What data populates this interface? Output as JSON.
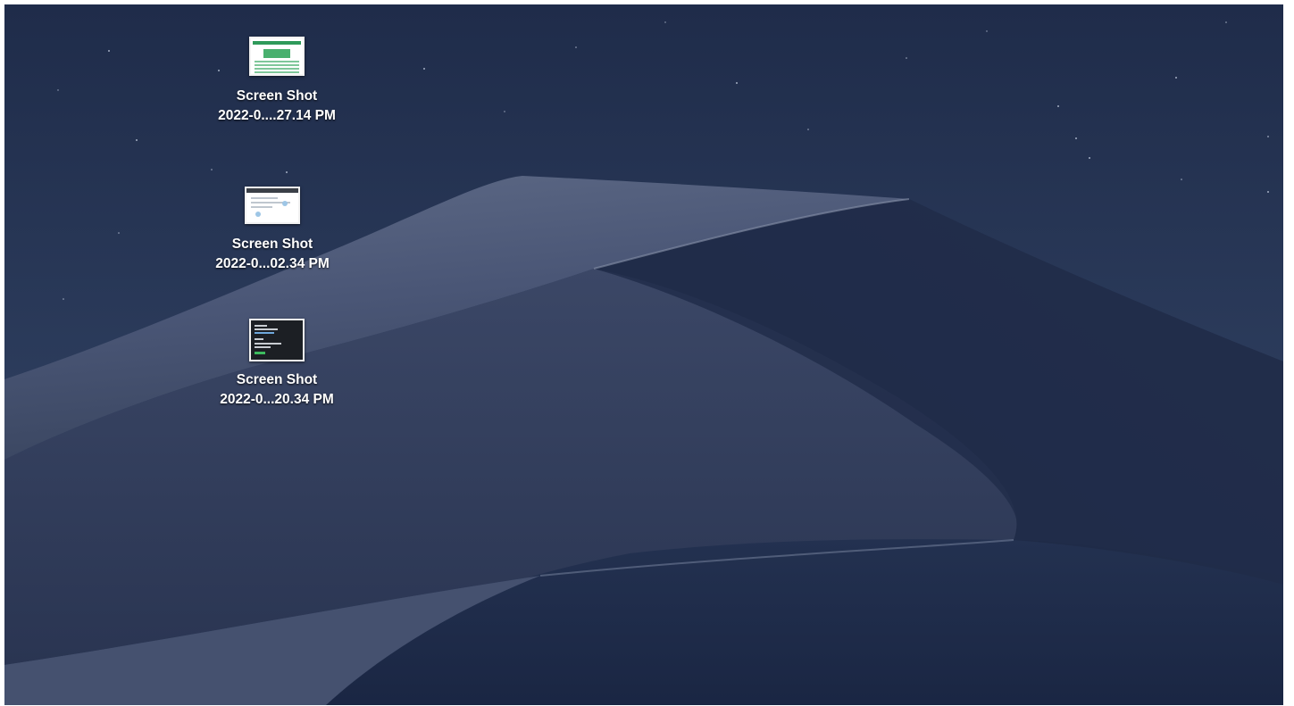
{
  "desktop": {
    "icons": [
      {
        "line1": "Screen Shot",
        "line2": "2022-0....27.14 PM"
      },
      {
        "line1": "Screen Shot",
        "line2": "2022-0...02.34 PM"
      },
      {
        "line1": "Screen Shot",
        "line2": "2022-0...20.34 PM"
      }
    ]
  }
}
